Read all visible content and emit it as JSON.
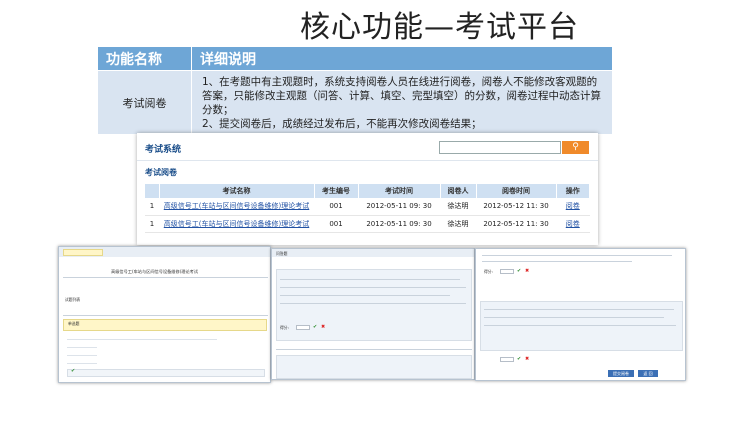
{
  "slide": {
    "title": "核心功能—考试平台"
  },
  "feature_table": {
    "headers": [
      "功能名称",
      "详细说明"
    ],
    "name": "考试阅卷",
    "desc_lines": [
      "1、在考题中有主观题时，系统支持阅卷人员在线进行阅卷，阅卷人不能修改客观题的",
      "答案，只能修改主观题（问答、计算、填空、完型填空）的分数，阅卷过程中动态计算",
      "分数；",
      "2、提交阅卷后，成绩经过发布后，不能再次修改阅卷结果；"
    ]
  },
  "exam_system": {
    "title": "考试系统",
    "search_value": "",
    "search_button": "Q",
    "sub_title": "考试阅卷",
    "columns": [
      "考试名称",
      "考生编号",
      "考试时间",
      "阅卷人",
      "阅卷时间",
      "操作"
    ],
    "rows": [
      {
        "no": "1",
        "name": "高级信号工(车站与区间信号设备维修)理论考试",
        "exam_id": "001",
        "exam_time": "2012-05-11 09: 30",
        "marker": "徐达明",
        "mark_time": "2012-05-12 11: 30",
        "action": "阅卷"
      },
      {
        "no": "1",
        "name": "高级信号工(车站与区间信号设备维修)理论考试",
        "exam_id": "001",
        "exam_time": "2012-05-11 09: 30",
        "marker": "徐达明",
        "mark_time": "2012-05-12 11: 30",
        "action": "阅卷"
      }
    ]
  },
  "thumb1": {
    "title": "高级信号工(车站与区间信号设备维修)理论考试",
    "section": "试题列表",
    "score_label": "单选题"
  },
  "thumb2": {
    "header": "问答题",
    "score_label": "得分:"
  },
  "thumb3": {
    "score_label": "得分:",
    "buttons": [
      "提交阅卷",
      "返 回"
    ]
  }
}
